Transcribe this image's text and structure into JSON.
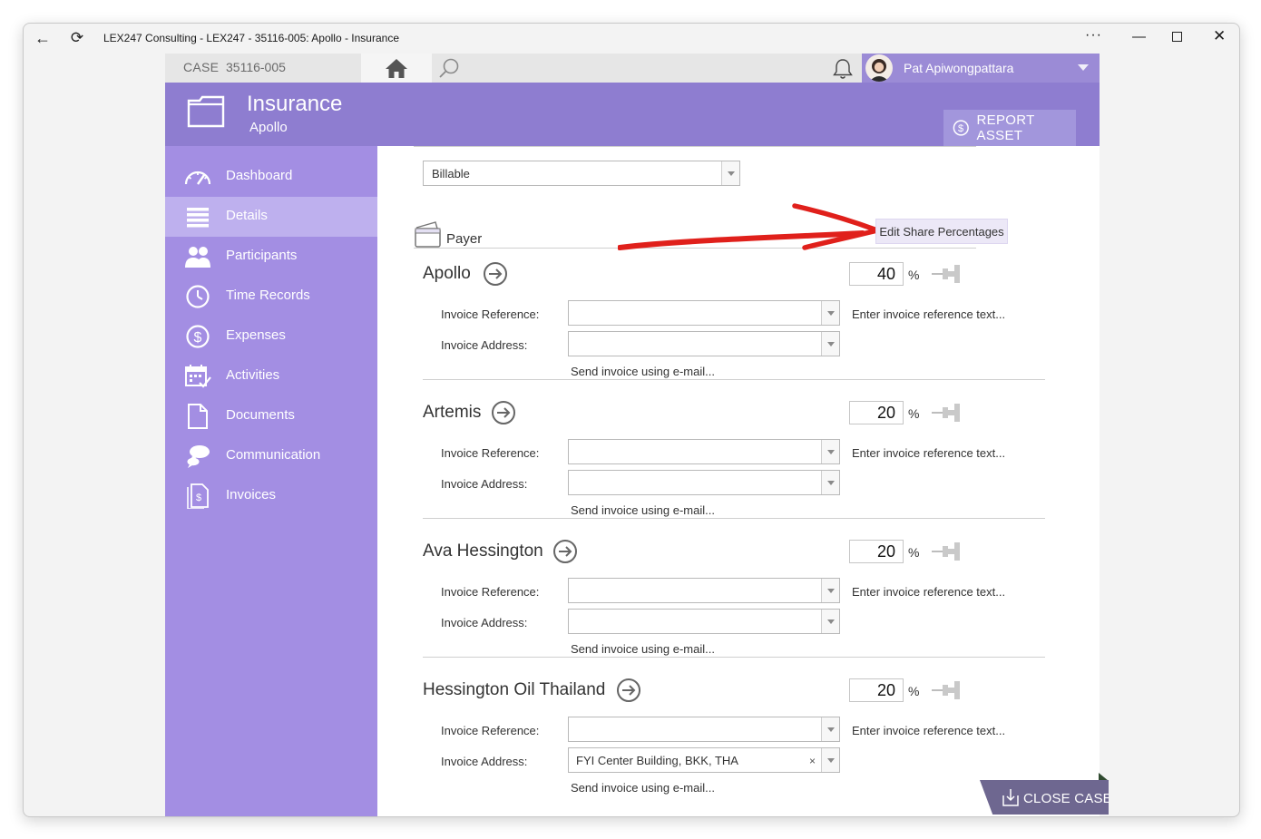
{
  "window": {
    "title": "LEX247 Consulting - LEX247 - 35116-005: Apollo - Insurance",
    "more_label": "···",
    "min_label": "—",
    "close_label": "✕"
  },
  "topbar": {
    "case_label": "CASE",
    "case_number": "35116-005",
    "user_name": "Pat Apiwongpattara"
  },
  "header": {
    "title": "Insurance",
    "subtitle": "Apollo",
    "report_button": "REPORT ASSET"
  },
  "sidebar": {
    "items": [
      {
        "label": "Dashboard",
        "icon": "dashboard-gauge-icon"
      },
      {
        "label": "Details",
        "icon": "details-list-icon",
        "active": true
      },
      {
        "label": "Participants",
        "icon": "participants-icon"
      },
      {
        "label": "Time Records",
        "icon": "clock-icon"
      },
      {
        "label": "Expenses",
        "icon": "dollar-circle-icon"
      },
      {
        "label": "Activities",
        "icon": "calendar-check-icon"
      },
      {
        "label": "Documents",
        "icon": "document-icon"
      },
      {
        "label": "Communication",
        "icon": "chat-bubbles-icon"
      },
      {
        "label": "Invoices",
        "icon": "invoice-icon"
      }
    ]
  },
  "content": {
    "billing_type": "Billable",
    "payer_section_label": "Payer",
    "edit_share_button": "Edit Share Percentages",
    "invoice_reference_label": "Invoice Reference:",
    "invoice_address_label": "Invoice Address:",
    "reference_hint": "Enter invoice reference text...",
    "send_invoice_link": "Send invoice using e-mail...",
    "percent_sign": "%",
    "payers": [
      {
        "name": "Apollo",
        "share": "40",
        "invoice_reference": "",
        "invoice_address": ""
      },
      {
        "name": "Artemis",
        "share": "20",
        "invoice_reference": "",
        "invoice_address": ""
      },
      {
        "name": "Ava Hessington",
        "share": "20",
        "invoice_reference": "",
        "invoice_address": ""
      },
      {
        "name": "Hessington Oil Thailand",
        "share": "20",
        "invoice_reference": "",
        "invoice_address": "FYI Center Building, BKK, THA"
      }
    ]
  },
  "footer": {
    "close_case_button": "CLOSE CASE",
    "clear_symbol": "×"
  },
  "colors": {
    "header_purple": "#8e7dd0",
    "sidebar_purple": "#a38ee3",
    "sidebar_active": "#beb0ee",
    "annotation_red": "#e0201b"
  }
}
